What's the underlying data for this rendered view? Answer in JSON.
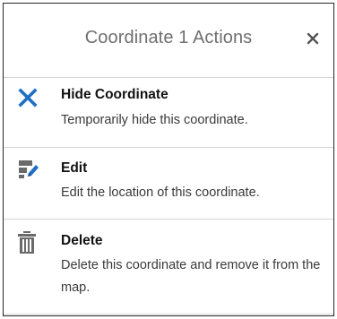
{
  "popup": {
    "title": "Coordinate 1 Actions",
    "close_icon": "close-icon"
  },
  "actions": [
    {
      "label": "Hide Coordinate",
      "description": "Temporarily hide this coordinate.",
      "icon": "x-icon",
      "icon_color": "#1f6fc5"
    },
    {
      "label": "Edit",
      "description": "Edit the location of this coordinate.",
      "icon": "edit-icon",
      "icon_color": "#1f6fc5"
    },
    {
      "label": "Delete",
      "description": "Delete this coordinate and remove it from the map.",
      "icon": "trash-icon",
      "icon_color": "#6a6a6a"
    }
  ]
}
